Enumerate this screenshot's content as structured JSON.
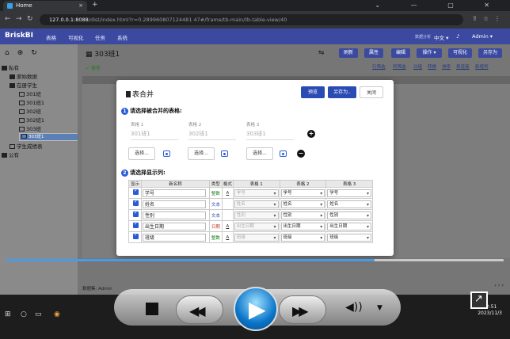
{
  "browser": {
    "tab_title": "Home",
    "tab_close": "×",
    "new_tab": "+",
    "window_controls": "⌄ — ▢ ✕",
    "url_host": "127.0.0.1:8088",
    "url_path": "/dist/index.html?r=0.289960807124481 47#/frame/tb-main/tb-table-view/40"
  },
  "app": {
    "logo": "BriskBI",
    "menu": [
      "表格",
      "可视化",
      "任务",
      "系统"
    ],
    "right_tag": "数据分析",
    "language": "中文 ▾",
    "user": "Admin ▾"
  },
  "tree": {
    "root": "私有",
    "items": [
      {
        "label": "原始数据",
        "type": "folder"
      },
      {
        "label": "在册学生",
        "type": "folder"
      },
      {
        "label": "301班",
        "type": "table"
      },
      {
        "label": "301班1",
        "type": "table"
      },
      {
        "label": "302班",
        "type": "table"
      },
      {
        "label": "302班1",
        "type": "table"
      },
      {
        "label": "303班",
        "type": "table"
      },
      {
        "label": "303班1",
        "type": "table",
        "selected": true
      },
      {
        "label": "学生成绩表",
        "type": "table"
      }
    ],
    "public": "公有"
  },
  "table_view": {
    "title": "303班1",
    "save_ok": "✓ 保存",
    "buttons": [
      "刷新",
      "属性",
      "编辑",
      "操作 ▾",
      "可视化",
      "另存为"
    ],
    "links": [
      "行筛选",
      "列筛选",
      "分组",
      "转换",
      "排序",
      "表连接",
      "新增列"
    ],
    "status": "数据集: Admin",
    "pagination": "‹   ›   ‹"
  },
  "modal": {
    "title": "表合并",
    "btn_preview": "预览",
    "btn_saveas": "另存为..",
    "btn_close": "关闭",
    "section1": "请选择被合并的表格:",
    "section1_num": "1",
    "tables": [
      {
        "label": "表格 1",
        "value": "301班1"
      },
      {
        "label": "表格 2",
        "value": "302班1"
      },
      {
        "label": "表格 3",
        "value": "303班1"
      }
    ],
    "select_label": "选择...",
    "add_symbol": "+",
    "remove_symbol": "−",
    "section2": "请选择显示列:",
    "section2_num": "2",
    "headers": [
      "显示",
      "新名称",
      "类型",
      "格式",
      "表格 1",
      "表格 2",
      "表格 3"
    ],
    "rows": [
      {
        "name": "学号",
        "type": "整数",
        "type_color": "#1b7d1b",
        "fmt": "A",
        "t1": "学号",
        "t2": "学号",
        "t3": "学号"
      },
      {
        "name": "姓名",
        "type": "文本",
        "type_color": "#2a3fb0",
        "fmt": "",
        "t1": "姓名",
        "t2": "姓名",
        "t3": "姓名"
      },
      {
        "name": "性别",
        "type": "文本",
        "type_color": "#2a3fb0",
        "fmt": "",
        "t1": "性别",
        "t2": "性别",
        "t3": "性别"
      },
      {
        "name": "出生日期",
        "type": "日期",
        "type_color": "#c0392b",
        "fmt": "A",
        "t1": "出生日期",
        "t2": "出生日期",
        "t3": "出生日期"
      },
      {
        "name": "班级",
        "type": "整数",
        "type_color": "#1b7d1b",
        "fmt": "A",
        "t1": "班级",
        "t2": "班级",
        "t3": "班级"
      }
    ]
  },
  "player": {
    "progress": 0.74
  },
  "taskbar": {
    "time": "12:51",
    "date": "2023/11/3"
  }
}
